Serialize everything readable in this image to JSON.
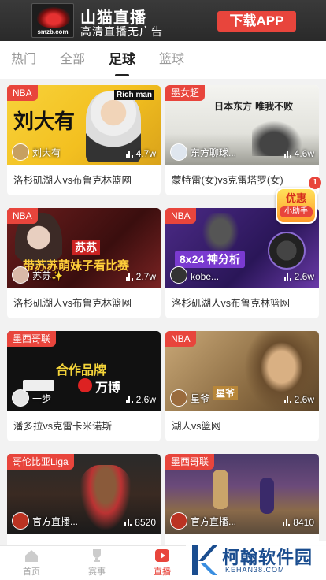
{
  "banner": {
    "logo_text": "smzb.com",
    "title": "山猫直播",
    "subtitle": "高清直播无广告",
    "download_label": "下载APP"
  },
  "tabs": [
    {
      "label": "热门",
      "active": false
    },
    {
      "label": "全部",
      "active": false
    },
    {
      "label": "足球",
      "active": true
    },
    {
      "label": "篮球",
      "active": false
    }
  ],
  "cards": [
    {
      "tag": "NBA",
      "thumb_text": "刘大有",
      "thumb_text2": "Rich man",
      "author": "刘大有",
      "views": "4.7w",
      "title": "洛杉矶湖人vs布鲁克林篮网"
    },
    {
      "tag": "墨女超",
      "thumb_text": "日本东方 唯我不败",
      "author": "东方聊球...",
      "views": "4.6w",
      "title": "蒙特雷(女)vs克雷塔罗(女)"
    },
    {
      "tag": "NBA",
      "thumb_text": "苏苏",
      "thumb_text2": "带苏苏萌妹子看比赛",
      "author": "苏苏✨",
      "views": "2.7w",
      "title": "洛杉矶湖人vs布鲁克林篮网"
    },
    {
      "tag": "NBA",
      "thumb_text": "8x24 神分析",
      "author": "kobe...",
      "views": "2.6w",
      "title": "洛杉矶湖人vs布鲁克林篮网"
    },
    {
      "tag": "墨西哥联",
      "thumb_text": "合作品牌",
      "thumb_text2": "万博",
      "author": "一步",
      "views": "2.6w",
      "title": "潘多拉vs克雷卡米诺斯"
    },
    {
      "tag": "NBA",
      "thumb_text": "星爷",
      "author": "星爷",
      "views": "2.6w",
      "title": "湖人vs篮网"
    },
    {
      "tag": "哥伦比亚Liga",
      "author": "官方直播...",
      "views": "8520",
      "title": ""
    },
    {
      "tag": "墨西哥联",
      "author": "官方直播...",
      "views": "8410",
      "title": ""
    }
  ],
  "promo": {
    "line1": "优惠",
    "line2": "小助手",
    "badge": "1"
  },
  "bottom_nav": [
    {
      "label": "首页",
      "icon": "home-icon",
      "active": false
    },
    {
      "label": "赛事",
      "icon": "trophy-icon",
      "active": false
    },
    {
      "label": "直播",
      "icon": "play-icon",
      "active": true
    }
  ],
  "watermark": {
    "title": "柯翰软件园",
    "url": "KEHAN38.COM"
  },
  "colors": {
    "accent": "#e8453c",
    "active_text": "#222222",
    "inactive_text": "#999999"
  }
}
